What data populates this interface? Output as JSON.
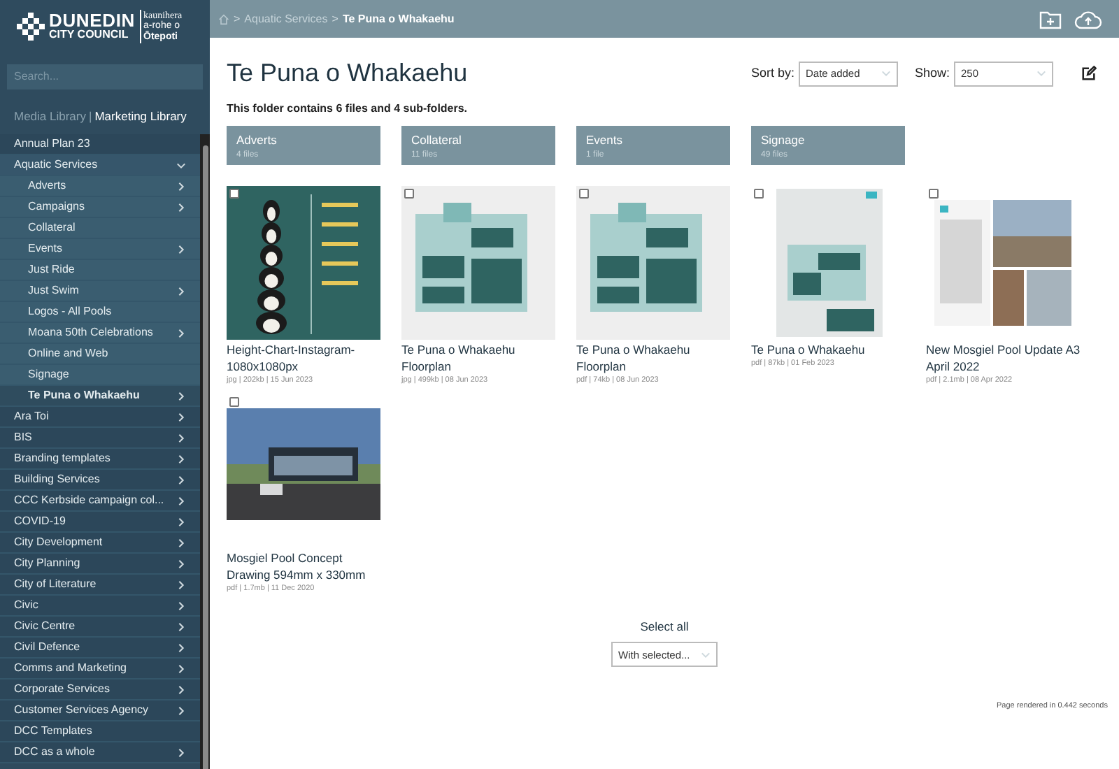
{
  "logo": {
    "name_line1": "DUNEDIN",
    "name_line2": "CITY COUNCIL",
    "maori_line1": "kaunihera",
    "maori_line2": "a-rohe o",
    "maori_line3": "Ōtepoti"
  },
  "search": {
    "placeholder": "Search..."
  },
  "libraries": [
    {
      "label": "Media Library",
      "selected": false
    },
    {
      "label": "Marketing Library",
      "selected": true
    }
  ],
  "library_separator": "|",
  "tree": [
    {
      "label": "Annual Plan 23",
      "has_subfolders": false,
      "expanded": false,
      "selected": false
    },
    {
      "label": "Aquatic Services",
      "has_subfolders": true,
      "expanded": true,
      "selected": false,
      "children": [
        {
          "label": "Adverts",
          "has_subfolders": true,
          "expanded": false,
          "selected": false
        },
        {
          "label": "Campaigns",
          "has_subfolders": true,
          "expanded": false,
          "selected": false
        },
        {
          "label": "Collateral",
          "has_subfolders": false,
          "expanded": false,
          "selected": false
        },
        {
          "label": "Events",
          "has_subfolders": true,
          "expanded": false,
          "selected": false
        },
        {
          "label": "Just Ride",
          "has_subfolders": false,
          "expanded": false,
          "selected": false
        },
        {
          "label": "Just Swim",
          "has_subfolders": true,
          "expanded": false,
          "selected": false
        },
        {
          "label": "Logos - All Pools",
          "has_subfolders": false,
          "expanded": false,
          "selected": false
        },
        {
          "label": "Moana 50th Celebrations",
          "has_subfolders": true,
          "expanded": false,
          "selected": false
        },
        {
          "label": "Online and Web",
          "has_subfolders": false,
          "expanded": false,
          "selected": false
        },
        {
          "label": "Signage",
          "has_subfolders": false,
          "expanded": false,
          "selected": false
        },
        {
          "label": "Te Puna o Whakaehu",
          "has_subfolders": true,
          "expanded": false,
          "selected": true
        }
      ]
    },
    {
      "label": "Ara Toi",
      "has_subfolders": true,
      "expanded": false,
      "selected": false
    },
    {
      "label": "BIS",
      "has_subfolders": true,
      "expanded": false,
      "selected": false
    },
    {
      "label": "Branding templates",
      "has_subfolders": true,
      "expanded": false,
      "selected": false
    },
    {
      "label": "Building Services",
      "has_subfolders": true,
      "expanded": false,
      "selected": false
    },
    {
      "label": "CCC Kerbside campaign col...",
      "has_subfolders": true,
      "expanded": false,
      "selected": false
    },
    {
      "label": "COVID-19",
      "has_subfolders": true,
      "expanded": false,
      "selected": false
    },
    {
      "label": "City Development",
      "has_subfolders": true,
      "expanded": false,
      "selected": false
    },
    {
      "label": "City Planning",
      "has_subfolders": true,
      "expanded": false,
      "selected": false
    },
    {
      "label": "City of Literature",
      "has_subfolders": true,
      "expanded": false,
      "selected": false
    },
    {
      "label": "Civic",
      "has_subfolders": true,
      "expanded": false,
      "selected": false
    },
    {
      "label": "Civic Centre",
      "has_subfolders": true,
      "expanded": false,
      "selected": false
    },
    {
      "label": "Civil Defence",
      "has_subfolders": true,
      "expanded": false,
      "selected": false
    },
    {
      "label": "Comms and Marketing",
      "has_subfolders": true,
      "expanded": false,
      "selected": false
    },
    {
      "label": "Corporate Services",
      "has_subfolders": true,
      "expanded": false,
      "selected": false
    },
    {
      "label": "Customer Services Agency",
      "has_subfolders": true,
      "expanded": false,
      "selected": false
    },
    {
      "label": "DCC Templates",
      "has_subfolders": false,
      "expanded": false,
      "selected": false
    },
    {
      "label": "DCC as a whole",
      "has_subfolders": true,
      "expanded": false,
      "selected": false
    }
  ],
  "breadcrumb": [
    {
      "label": "Aquatic Services",
      "current": false
    },
    {
      "label": "Te Puna o Whakaehu",
      "current": true
    }
  ],
  "breadcrumb_separator": ">",
  "title": "Te Puna o Whakaehu",
  "sort": {
    "label": "Sort by:",
    "value": "Date added"
  },
  "show": {
    "label": "Show:",
    "value": "250"
  },
  "summary": "This folder contains 6 files and 4 sub-folders.",
  "folders": [
    {
      "name": "Adverts",
      "count": "4 files"
    },
    {
      "name": "Collateral",
      "count": "11 files"
    },
    {
      "name": "Events",
      "count": "1 file"
    },
    {
      "name": "Signage",
      "count": "49 files"
    }
  ],
  "files": [
    {
      "name": "Height-Chart-Instagram-1080x1080px",
      "meta": "jpg | 202kb | 15 Jun 2023",
      "checked": false
    },
    {
      "name": "Te Puna o Whakaehu Floorplan",
      "meta": "jpg | 499kb | 08 Jun 2023",
      "checked": false
    },
    {
      "name": "Te Puna o Whakaehu Floorplan",
      "meta": "pdf | 74kb | 08 Jun 2023",
      "checked": false
    },
    {
      "name": "Te Puna o Whakaehu",
      "meta": "pdf | 87kb | 01 Feb 2023",
      "checked": false
    },
    {
      "name": "New Mosgiel Pool Update A3 April 2022",
      "meta": "pdf | 2.1mb | 08 Apr 2022",
      "checked": false
    },
    {
      "name": "Mosgiel Pool Concept Drawing 594mm x 330mm",
      "meta": "pdf | 1.7mb | 11 Dec 2020",
      "checked": false
    }
  ],
  "select_all": "Select all",
  "bulk_action": {
    "value": "With selected..."
  },
  "footer": "Page rendered in 0.442 seconds"
}
